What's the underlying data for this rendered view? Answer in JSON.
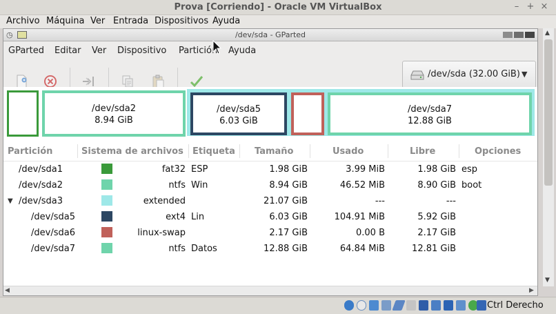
{
  "vbox": {
    "title": "Prova [Corriendo] - Oracle VM VirtualBox",
    "menu": [
      "Archivo",
      "Máquina",
      "Ver",
      "Entrada",
      "Dispositivos",
      "Ayuda"
    ],
    "host_key": "Ctrl Derecho"
  },
  "gparted": {
    "title": "/dev/sda - GParted",
    "menu": [
      "GParted",
      "Editar",
      "Ver",
      "Dispositivo",
      "Partición",
      "Ayuda"
    ],
    "device": "/dev/sda  (32.00 GiB)",
    "map": [
      {
        "name": "",
        "size": "",
        "color": "#3a9a3a"
      },
      {
        "name": "/dev/sda2",
        "size": "8.94 GiB",
        "color": "#6fd4ab"
      },
      {
        "name": "/dev/sda5",
        "size": "6.03 GiB",
        "color": "#2d4763"
      },
      {
        "name": "",
        "size": "",
        "color": "#c0615a"
      },
      {
        "name": "/dev/sda7",
        "size": "12.88 GiB",
        "color": "#6fd4ab"
      }
    ],
    "columns": [
      "Partición",
      "Sistema de archivos",
      "Etiqueta",
      "Tamaño",
      "Usado",
      "Libre",
      "Opciones"
    ],
    "rows": [
      {
        "part": "/dev/sda1",
        "fs": "fat32",
        "label": "ESP",
        "size": "1.98 GiB",
        "used": "3.99 MiB",
        "free": "1.98 GiB",
        "flags": "esp",
        "color": "#3a9a3a"
      },
      {
        "part": "/dev/sda2",
        "fs": "ntfs",
        "label": "Win",
        "size": "8.94 GiB",
        "used": "46.52 MiB",
        "free": "8.90 GiB",
        "flags": "boot",
        "color": "#6fd4ab"
      },
      {
        "part": "/dev/sda3",
        "fs": "extended",
        "label": "",
        "size": "21.07 GiB",
        "used": "---",
        "free": "---",
        "flags": "",
        "color": "#9ee8e8"
      },
      {
        "part": "/dev/sda5",
        "fs": "ext4",
        "label": "Lin",
        "size": "6.03 GiB",
        "used": "104.91 MiB",
        "free": "5.92 GiB",
        "flags": "",
        "color": "#2d4763"
      },
      {
        "part": "/dev/sda6",
        "fs": "linux-swap",
        "label": "",
        "size": "2.17 GiB",
        "used": "0.00 B",
        "free": "2.17 GiB",
        "flags": "",
        "color": "#c0615a"
      },
      {
        "part": "/dev/sda7",
        "fs": "ntfs",
        "label": "Datos",
        "size": "12.88 GiB",
        "used": "64.84 MiB",
        "free": "12.81 GiB",
        "flags": "",
        "color": "#6fd4ab"
      }
    ]
  },
  "icons": {
    "new": "new-icon",
    "delete": "delete-icon",
    "resize": "resize-icon",
    "copy": "copy-icon",
    "paste": "paste-icon",
    "apply": "apply-icon",
    "disk": "disk-icon"
  }
}
